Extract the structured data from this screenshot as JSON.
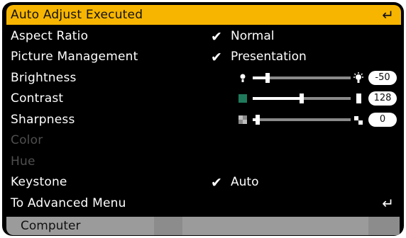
{
  "menu": {
    "items": [
      {
        "label": "Auto Adjust Executed",
        "enter": "↵",
        "selected": true
      },
      {
        "label": "Aspect Ratio",
        "check": "✔",
        "value": "Normal"
      },
      {
        "label": "Picture Management",
        "check": "✔",
        "value": "Presentation"
      },
      {
        "label": "Brightness",
        "slider": {
          "value_text": "-50",
          "fraction": 0.15
        }
      },
      {
        "label": "Contrast",
        "slider": {
          "value_text": "128",
          "fraction": 0.5
        }
      },
      {
        "label": "Sharpness",
        "slider": {
          "value_text": "0",
          "fraction": 0.05
        }
      },
      {
        "label": "Color",
        "disabled": true
      },
      {
        "label": "Hue",
        "disabled": true
      },
      {
        "label": "Keystone",
        "check": "✔",
        "value": "Auto"
      },
      {
        "label": "To Advanced Menu",
        "enter": "↵"
      }
    ]
  },
  "status_bar": {
    "source": "Computer"
  },
  "colors": {
    "highlight": "#f7b500",
    "background": "#000000",
    "disabled": "#4f4f4f",
    "status_bar": "#9b9b9b"
  },
  "icons": {
    "brightness_low": "small-bulb-icon",
    "brightness_high": "bright-bulb-icon",
    "contrast_low": "green-square-icon",
    "contrast_high": "white-bar-icon",
    "sharpness_low": "checker-square-icon",
    "sharpness_high": "sharp-corner-icon",
    "enter": "enter-arrow-icon",
    "check": "checkmark-icon"
  }
}
